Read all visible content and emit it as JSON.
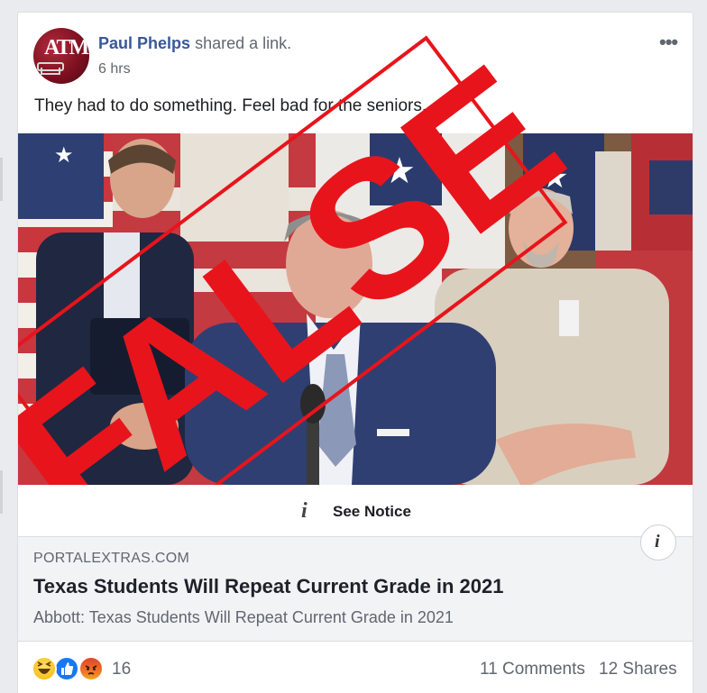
{
  "post": {
    "author": "Paul Phelps",
    "action": "shared a link.",
    "time": "6 hrs",
    "text": "They had to do something. Feel bad for the seniors.",
    "avatar_monogram": "ATM",
    "more_icon": "ellipsis-icon"
  },
  "stamp": {
    "label": "FALSE",
    "color": "#e8141b"
  },
  "notice": {
    "label": "See Notice",
    "icon": "info-icon"
  },
  "link_preview": {
    "domain": "PORTALEXTRAS.COM",
    "title": "Texas Students Will Repeat Current Grade in 2021",
    "description": "Abbott: Texas Students Will Repeat Current Grade in 2021",
    "info_icon": "i"
  },
  "footer": {
    "reactions": [
      "haha",
      "like",
      "angry"
    ],
    "reaction_count": "16",
    "comments": "11 Comments",
    "shares": "12 Shares"
  },
  "colors": {
    "link_blue": "#385898",
    "secondary_text": "#606770",
    "like_blue": "#1877f2"
  }
}
